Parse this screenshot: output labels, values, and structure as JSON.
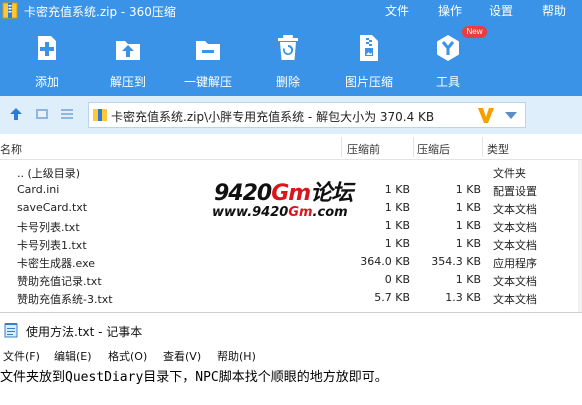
{
  "zip_window": {
    "title": "卡密充值系统.zip - 360压缩",
    "menu": [
      "文件",
      "操作",
      "设置",
      "帮助"
    ],
    "toolbar": [
      {
        "label": "添加",
        "icon": "add-icon"
      },
      {
        "label": "解压到",
        "icon": "extract-to-icon"
      },
      {
        "label": "一键解压",
        "icon": "one-click-extract-icon"
      },
      {
        "label": "删除",
        "icon": "delete-icon"
      },
      {
        "label": "图片压缩",
        "icon": "image-compress-icon"
      },
      {
        "label": "工具",
        "icon": "tools-icon",
        "badge": "New"
      }
    ],
    "address": {
      "path": "卡密充值系统.zip\\小胖专用充值系统 - 解包大小为 370.4 KB",
      "logo": "V"
    },
    "columns": {
      "name": "名称",
      "compressed": "压缩前",
      "after": "压缩后",
      "type": "类型"
    },
    "files": [
      {
        "name": ".. (上级目录)",
        "before": "",
        "after": "",
        "type": "文件夹"
      },
      {
        "name": "Card.ini",
        "before": "1 KB",
        "after": "1 KB",
        "type": "配置设置"
      },
      {
        "name": "saveCard.txt",
        "before": "1 KB",
        "after": "1 KB",
        "type": "文本文档"
      },
      {
        "name": "卡号列表.txt",
        "before": "1 KB",
        "after": "1 KB",
        "type": "文本文档"
      },
      {
        "name": "卡号列表1.txt",
        "before": "1 KB",
        "after": "1 KB",
        "type": "文本文档"
      },
      {
        "name": "卡密生成器.exe",
        "before": "364.0 KB",
        "after": "354.3 KB",
        "type": "应用程序"
      },
      {
        "name": "赞助充值记录.txt",
        "before": "0 KB",
        "after": "1 KB",
        "type": "文本文档"
      },
      {
        "name": "赞助充值系统-3.txt",
        "before": "5.7 KB",
        "after": "1.3 KB",
        "type": "文本文档"
      }
    ],
    "watermark": {
      "line1_black": "9420",
      "line1_red": "Gm",
      "line1_tail": "论坛",
      "line2_black1": "www.9420",
      "line2_red": "Gm",
      "line2_black2": ".com"
    }
  },
  "notepad": {
    "title": "使用方法.txt - 记事本",
    "menu": [
      "文件(F)",
      "编辑(E)",
      "格式(O)",
      "查看(V)",
      "帮助(H)"
    ],
    "content": "文件夹放到QuestDiary目录下，NPC脚本找个顺眼的地方放即可。"
  },
  "colors": {
    "toolbar_blue": "#3a93e6",
    "address_bg": "#dfeefb",
    "badge_red": "#ea3e3e",
    "logo_orange": "#f5a000"
  }
}
